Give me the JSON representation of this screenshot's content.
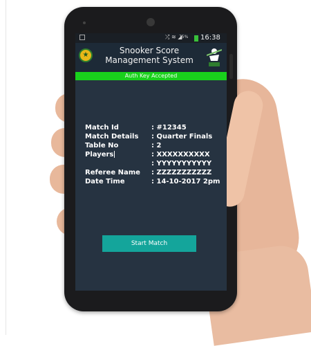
{
  "status_bar": {
    "signal_text": "⤮ ≋ ◢",
    "battery_percent": "75%",
    "time": "16:38"
  },
  "app": {
    "title_line1": "Snooker Score",
    "title_line2": "Management System"
  },
  "auth_banner": "Auth Key Accepted",
  "details": {
    "match_id_label": "Match Id",
    "match_id_value": ": #12345",
    "match_details_label": "Match Details",
    "match_details_value": ": Quarter Finals",
    "table_no_label": "Table No",
    "table_no_value": ": 2",
    "players_label": "Players",
    "player1_value": ": XXXXXXXXXX",
    "player2_value": ": YYYYYYYYYYY",
    "referee_label": "Referee Name",
    "referee_value": ": ZZZZZZZZZZZ",
    "datetime_label": "Date Time",
    "datetime_value": ": 14-10-2017 2pm"
  },
  "start_button_label": "Start Match",
  "colors": {
    "screen_bg": "#263341",
    "auth_green": "#19d11c",
    "button_teal": "#14a59b"
  }
}
